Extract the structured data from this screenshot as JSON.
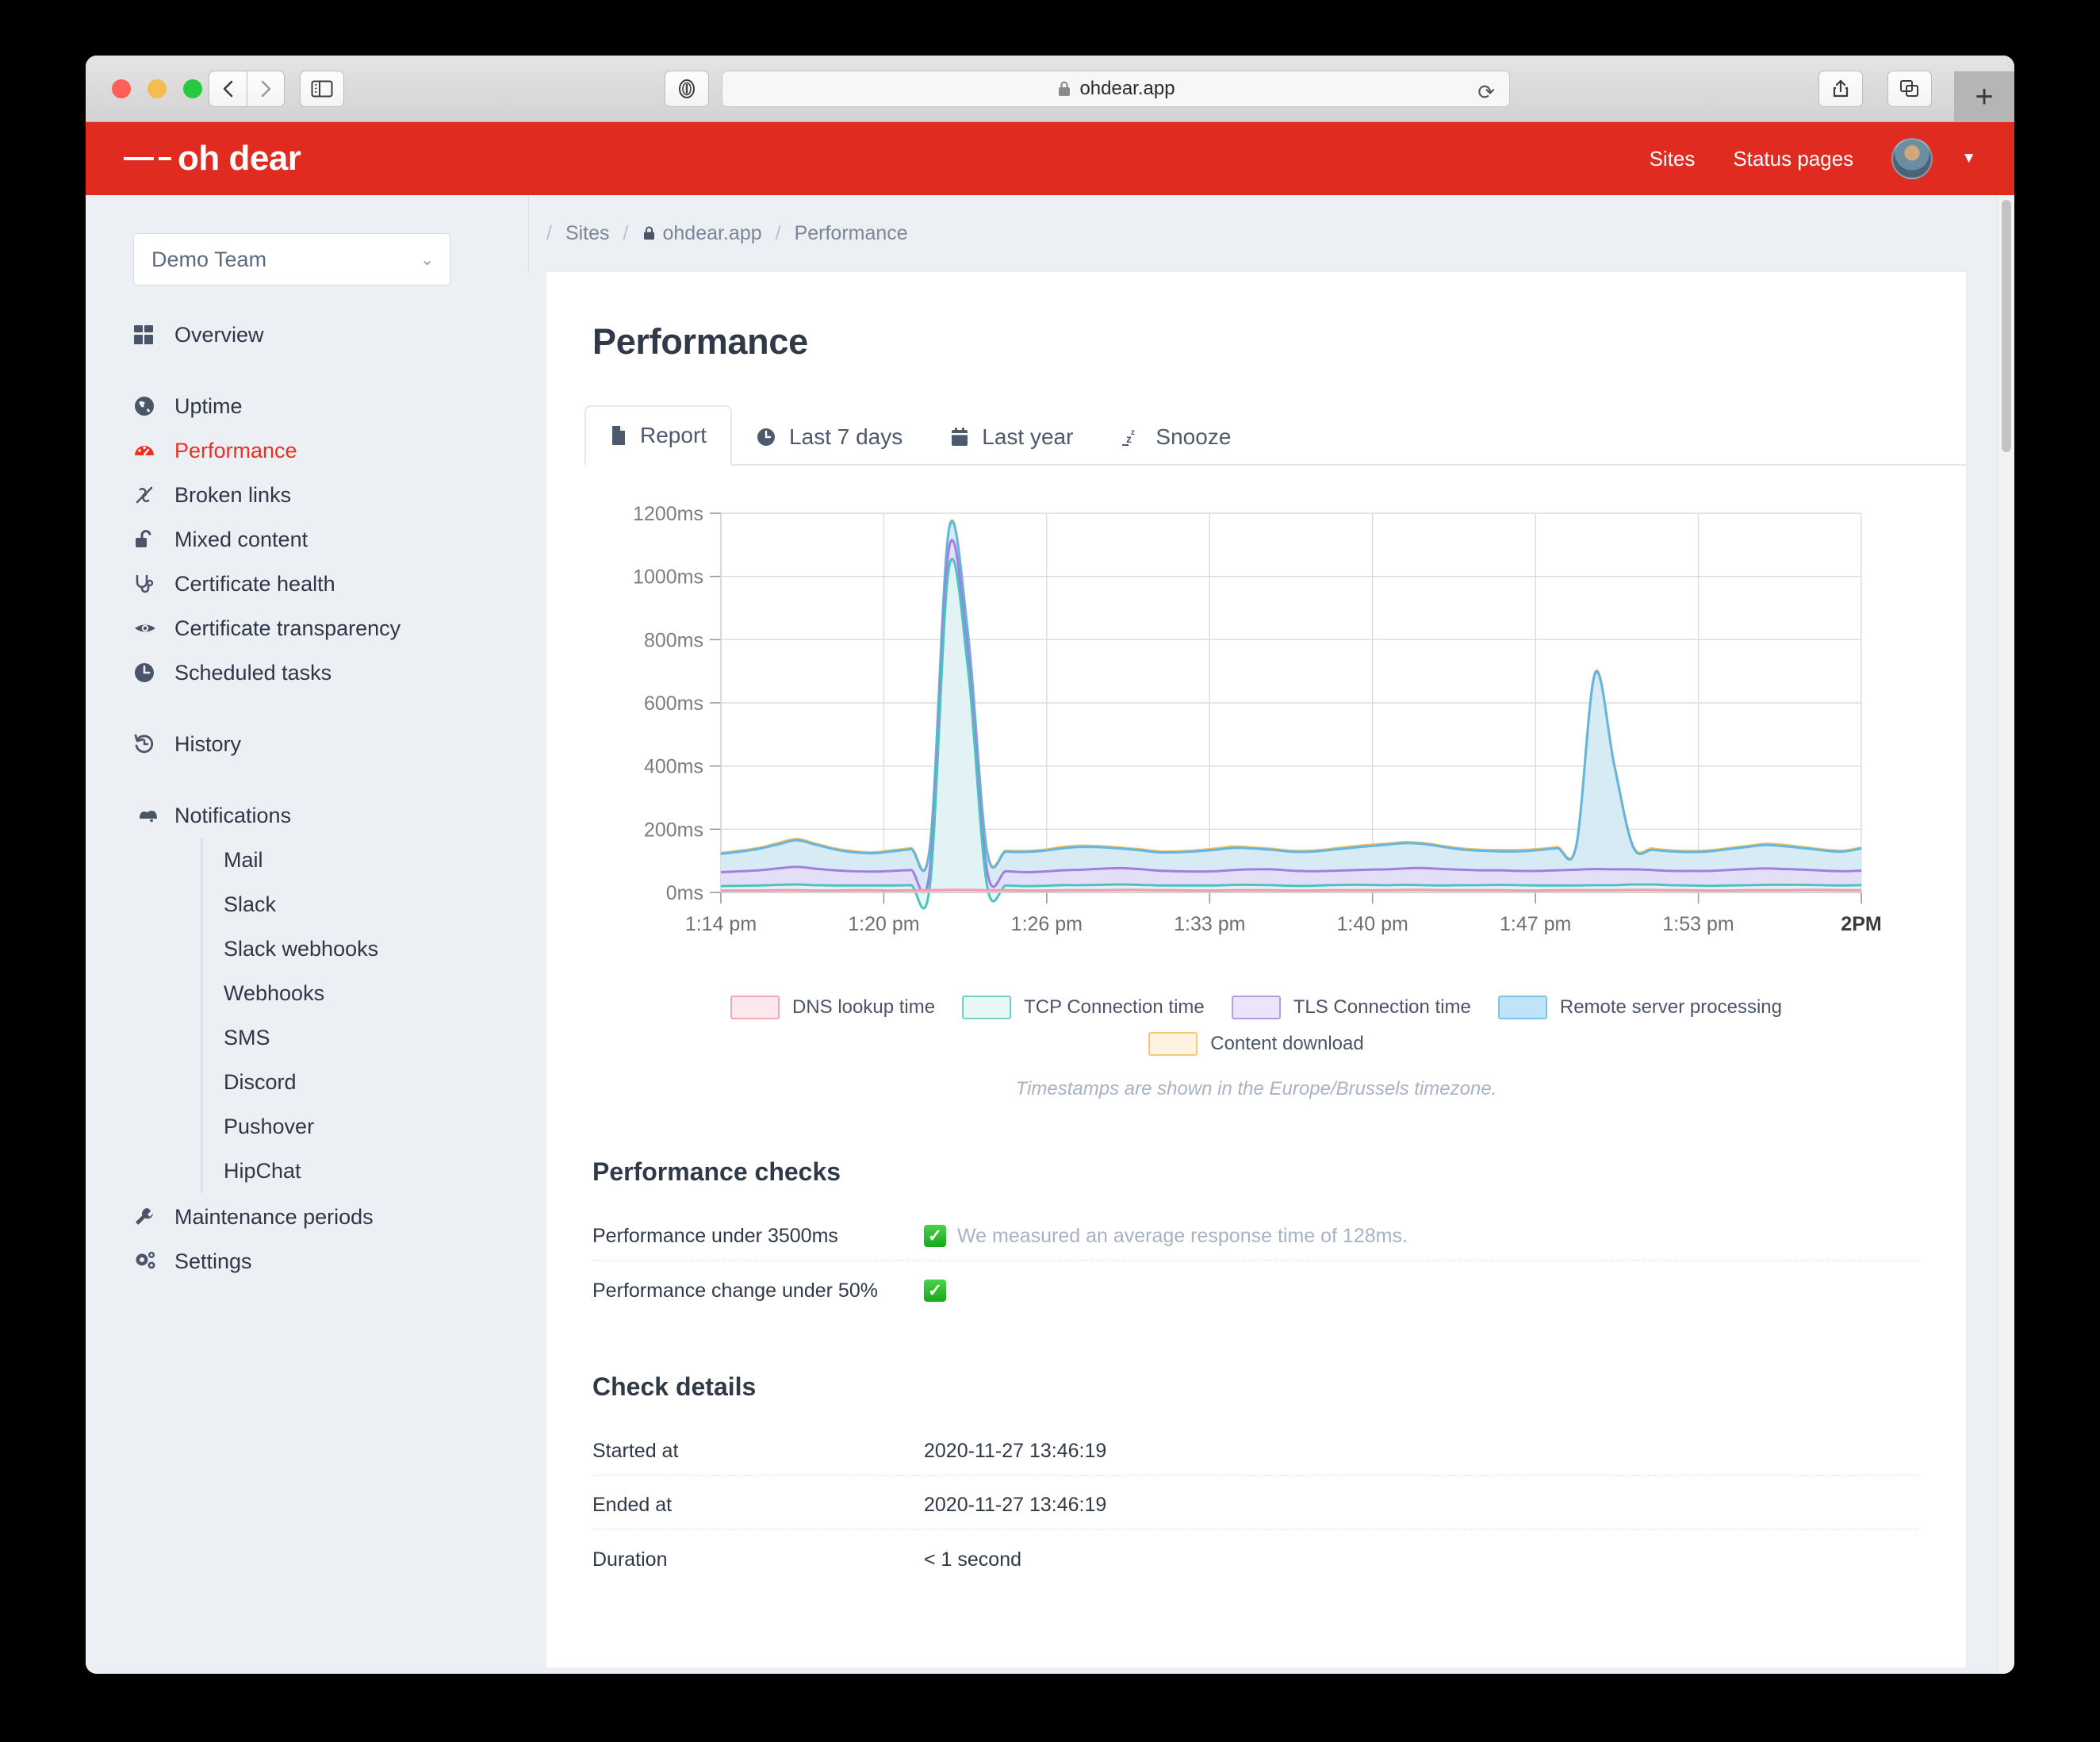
{
  "browser": {
    "url": "ohdear.app",
    "lock_icon": "lock-icon",
    "back_icon": "chevron-left-icon",
    "forward_icon": "chevron-right-icon",
    "sidebar_icon": "sidebar-icon",
    "reader_icon": "reader-mode-icon",
    "reload_icon": "reload-icon",
    "share_icon": "share-icon",
    "tabs_icon": "tab-overview-icon",
    "new_tab_label": "+"
  },
  "header": {
    "logo": "oh dear",
    "links": [
      "Sites",
      "Status pages"
    ],
    "avatar": "user-avatar",
    "caret": "chevron-down-icon"
  },
  "sidebar": {
    "team": {
      "name": "Demo Team",
      "caret": "chevron-down-icon"
    },
    "group1": [
      {
        "label": "Overview",
        "icon": "grid-icon",
        "active": false
      }
    ],
    "group2": [
      {
        "label": "Uptime",
        "icon": "globe-icon",
        "active": false
      },
      {
        "label": "Performance",
        "icon": "gauge-icon",
        "active": true
      },
      {
        "label": "Broken links",
        "icon": "broken-link-icon",
        "active": false
      },
      {
        "label": "Mixed content",
        "icon": "unlock-icon",
        "active": false
      },
      {
        "label": "Certificate health",
        "icon": "stethoscope-icon",
        "active": false
      },
      {
        "label": "Certificate transparency",
        "icon": "eye-icon",
        "active": false
      },
      {
        "label": "Scheduled tasks",
        "icon": "clock-icon",
        "active": false
      }
    ],
    "group3": [
      {
        "label": "History",
        "icon": "history-icon",
        "active": false
      }
    ],
    "notifications": {
      "label": "Notifications",
      "icon": "bells-icon"
    },
    "notification_children": [
      "Mail",
      "Slack",
      "Slack webhooks",
      "Webhooks",
      "SMS",
      "Discord",
      "Pushover",
      "HipChat"
    ],
    "group4": [
      {
        "label": "Maintenance periods",
        "icon": "wrench-icon",
        "active": false
      },
      {
        "label": "Settings",
        "icon": "gears-icon",
        "active": false
      }
    ]
  },
  "breadcrumb": {
    "lead": "/",
    "items": [
      "Sites",
      "ohdear.app",
      "Performance"
    ],
    "lock_icon": "lock-icon",
    "sep": "/"
  },
  "main": {
    "page_title": "Performance",
    "tabs": [
      {
        "label": "Report",
        "icon": "document-icon",
        "active": true
      },
      {
        "label": "Last 7 days",
        "icon": "clock-icon",
        "active": false
      },
      {
        "label": "Last year",
        "icon": "calendar-icon",
        "active": false
      },
      {
        "label": "Snooze",
        "icon": "snooze-icon",
        "active": false
      }
    ],
    "timezone_note": "Timestamps are shown in the Europe/Brussels timezone.",
    "performance_checks": {
      "title": "Performance checks",
      "rows": [
        {
          "key": "Performance under 3500ms",
          "badge": "✓",
          "value": "We measured an average response time of 128ms."
        },
        {
          "key": "Performance change under 50%",
          "badge": "✓",
          "value": ""
        }
      ]
    },
    "check_details": {
      "title": "Check details",
      "rows": [
        {
          "key": "Started at",
          "value": "2020-11-27 13:46:19"
        },
        {
          "key": "Ended at",
          "value": "2020-11-27 13:46:19"
        },
        {
          "key": "Duration",
          "value": "< 1 second"
        }
      ]
    }
  },
  "chart_data": {
    "type": "area",
    "title": "",
    "xlabel": "",
    "ylabel": "",
    "ylim": [
      0,
      1200
    ],
    "ytick_labels": [
      "0ms",
      "200ms",
      "400ms",
      "600ms",
      "800ms",
      "1000ms",
      "1200ms"
    ],
    "yticks": [
      0,
      200,
      400,
      600,
      800,
      1000,
      1200
    ],
    "xtick_labels": [
      "1:14 pm",
      "1:20 pm",
      "1:26 pm",
      "1:33 pm",
      "1:40 pm",
      "1:47 pm",
      "1:53 pm",
      "2PM"
    ],
    "grid": true,
    "legend_position": "bottom",
    "stacked": true,
    "series": [
      {
        "name": "DNS lookup time",
        "fill": "#fde8ee",
        "stroke": "#f19ab0",
        "values": [
          6,
          6,
          6,
          7,
          7,
          6,
          6,
          7,
          7,
          6,
          7,
          7,
          8,
          8,
          7,
          7,
          6,
          6,
          7,
          7,
          7,
          8,
          8,
          7,
          7,
          6,
          6,
          7,
          7,
          7,
          6,
          6,
          7,
          7,
          7,
          7,
          8,
          8,
          7,
          7,
          7,
          7,
          6,
          6,
          7,
          7,
          7,
          7,
          8,
          8,
          7,
          7,
          6,
          6,
          7,
          7,
          7,
          8,
          8,
          7,
          7
        ]
      },
      {
        "name": "TCP Connection time",
        "fill": "#e3f6f4",
        "stroke": "#4cc4bd",
        "values": [
          14,
          15,
          16,
          17,
          18,
          17,
          16,
          15,
          15,
          16,
          16,
          17,
          1020,
          700,
          16,
          15,
          14,
          15,
          16,
          16,
          17,
          17,
          16,
          15,
          15,
          16,
          16,
          17,
          17,
          16,
          15,
          15,
          16,
          17,
          17,
          16,
          16,
          15,
          15,
          16,
          16,
          17,
          17,
          16,
          15,
          15,
          16,
          16,
          17,
          17,
          16,
          15,
          15,
          16,
          16,
          17,
          17,
          16,
          15,
          15,
          16
        ]
      },
      {
        "name": "TLS Connection time",
        "fill": "#e4ddf7",
        "stroke": "#a27ee0",
        "values": [
          44,
          46,
          48,
          52,
          56,
          52,
          48,
          45,
          44,
          46,
          48,
          50,
          60,
          52,
          47,
          45,
          44,
          45,
          47,
          49,
          51,
          52,
          50,
          47,
          45,
          44,
          45,
          47,
          49,
          50,
          48,
          46,
          45,
          46,
          48,
          50,
          52,
          54,
          52,
          49,
          47,
          46,
          45,
          46,
          48,
          50,
          51,
          50,
          48,
          46,
          45,
          46,
          47,
          49,
          51,
          52,
          50,
          48,
          46,
          45,
          46
        ]
      },
      {
        "name": "Remote server processing",
        "fill": "#cfe9f6",
        "stroke": "#62b6e2",
        "values": [
          58,
          62,
          68,
          76,
          84,
          76,
          66,
          60,
          58,
          62,
          66,
          70,
          60,
          58,
          60,
          62,
          64,
          66,
          70,
          72,
          68,
          62,
          60,
          58,
          60,
          64,
          68,
          70,
          66,
          62,
          60,
          62,
          66,
          70,
          74,
          78,
          80,
          76,
          70,
          64,
          62,
          60,
          62,
          66,
          70,
          74,
          620,
          330,
          70,
          64,
          62,
          60,
          62,
          66,
          70,
          74,
          72,
          68,
          64,
          62,
          70
        ]
      },
      {
        "name": "Content download",
        "fill": "#fdf1dc",
        "stroke": "#f0c05a",
        "values": [
          3,
          3,
          3,
          4,
          4,
          3,
          3,
          3,
          3,
          3,
          3,
          4,
          3,
          3,
          3,
          3,
          3,
          3,
          4,
          4,
          3,
          3,
          3,
          3,
          3,
          3,
          4,
          4,
          3,
          3,
          3,
          3,
          3,
          4,
          4,
          3,
          3,
          3,
          3,
          3,
          3,
          4,
          4,
          3,
          3,
          3,
          3,
          3,
          4,
          4,
          3,
          3,
          3,
          3,
          3,
          4,
          4,
          3,
          3,
          3,
          3
        ]
      }
    ],
    "peaks": [
      {
        "x_label": "~1:19 pm",
        "value": 1150
      },
      {
        "x_label": "~1:47 pm",
        "value": 675
      }
    ]
  }
}
